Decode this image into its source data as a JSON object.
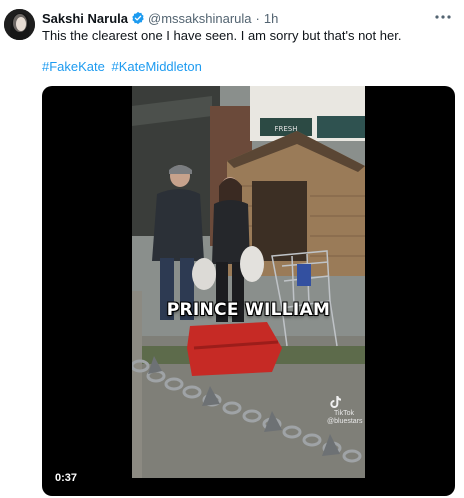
{
  "author": {
    "name": "Sakshi Narula",
    "handle": "@mssakshinarula",
    "separator": "·",
    "time": "1h",
    "verified_color": "#1d9bf0"
  },
  "tweet": {
    "text": "This the clearest one I have seen. I am sorry but that's not her.",
    "hashtags": [
      "#FakeKate",
      "#KateMiddleton"
    ]
  },
  "media": {
    "caption": "PRINCE WILLIAM",
    "duration": "0:37",
    "watermark": {
      "brand": "TikTok",
      "user": "@bluestars"
    }
  },
  "colors": {
    "link": "#1d9bf0",
    "text": "#0f1419",
    "secondary": "#536471"
  }
}
